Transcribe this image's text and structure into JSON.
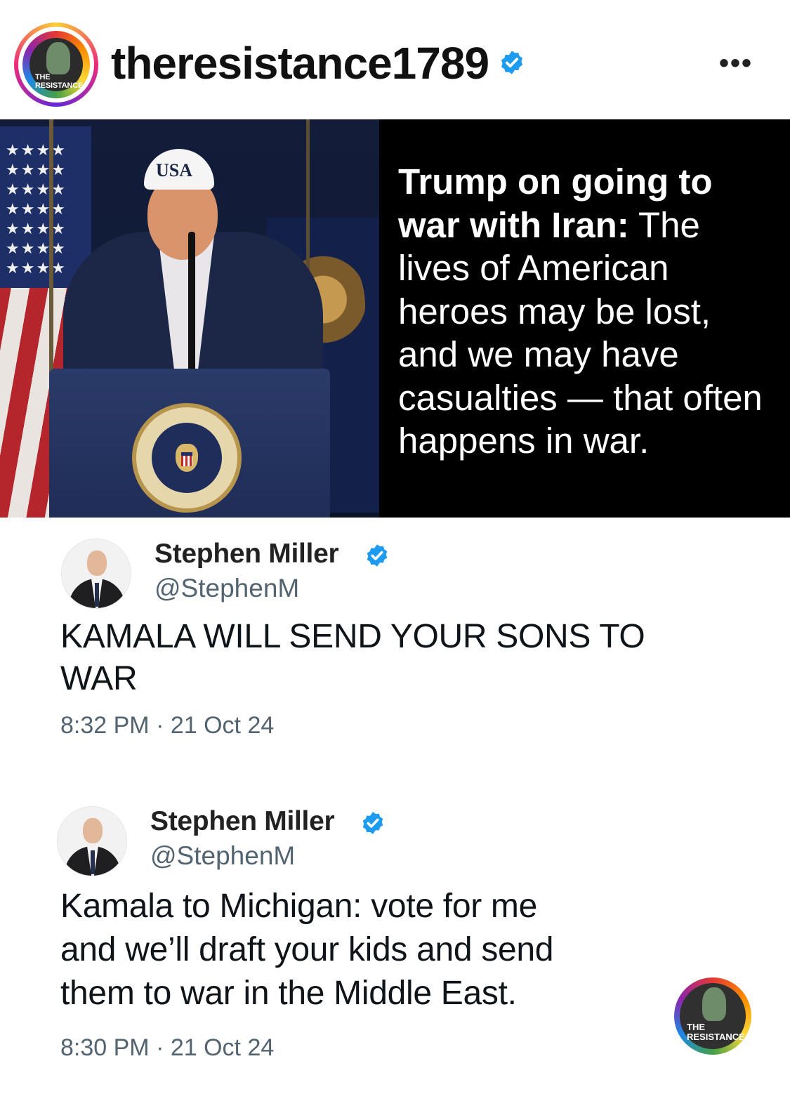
{
  "header": {
    "username": "theresistance1789",
    "avatar_text_line1": "THE",
    "avatar_text_line2": "RESISTANCE",
    "more_label": "•••"
  },
  "post_image": {
    "cap_text": "USA",
    "quote_bold": "Trump on going to war with Iran:",
    "quote_rest": " The lives of American heroes may be lost, and we may have casualties — that often happens in war."
  },
  "tweets": [
    {
      "name": "Stephen Miller",
      "handle": "@StephenM",
      "text_line1": "KAMALA WILL SEND YOUR SONS TO",
      "text_line2": "WAR",
      "time": "8:32 PM · 21 Oct 24"
    },
    {
      "name": "Stephen Miller",
      "handle": "@StephenM",
      "text_line1": "Kamala to Michigan: vote for me",
      "text_line2": "and we’ll draft your kids and send",
      "text_line3": "them to war in the Middle East.",
      "time": "8:30 PM · 21 Oct 24"
    }
  ],
  "watermark": {
    "line1": "THE",
    "line2": "RESISTANCE"
  },
  "colors": {
    "verified_blue": "#1d9bf0",
    "text_secondary": "#536471"
  },
  "icons": [
    "verified-badge-icon",
    "more-options-icon"
  ]
}
